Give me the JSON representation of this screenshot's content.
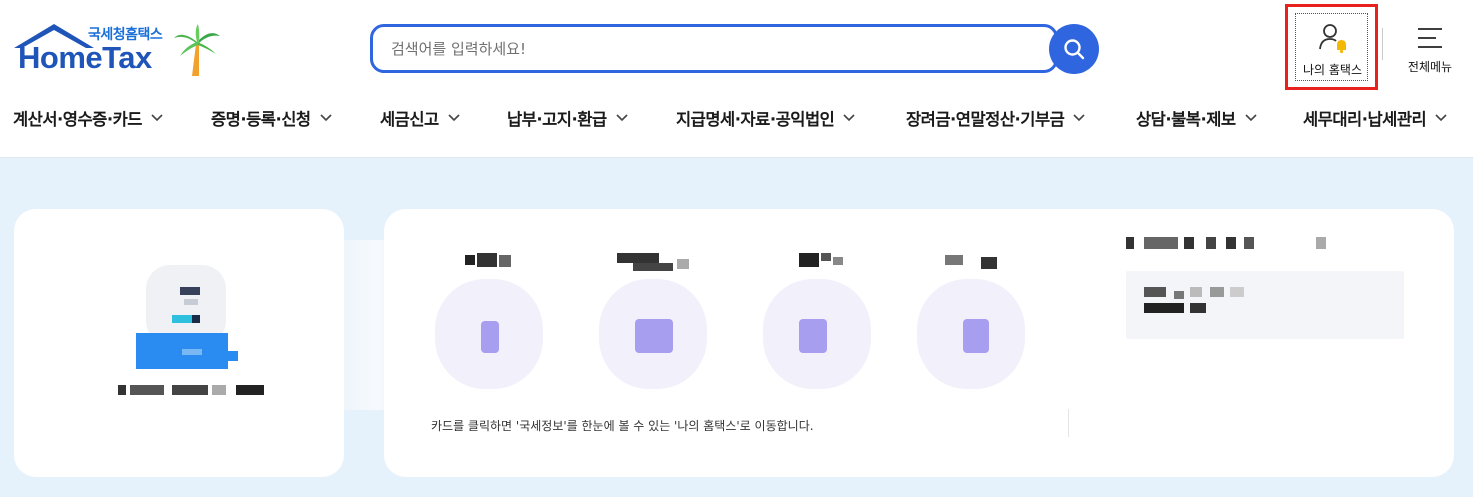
{
  "brand": {
    "sub": "국세청홈택스",
    "main": "HomeTax",
    "colors": {
      "primary": "#2f66e0",
      "logo": "#1f55b8",
      "highlight": "#e8201e"
    }
  },
  "search": {
    "placeholder": "검색어를 입력하세요!",
    "icon": "search-icon"
  },
  "header_actions": {
    "my_hometax": {
      "label": "나의 홈택스",
      "icon": "user-bell-icon"
    },
    "all_menu": {
      "label": "전체메뉴",
      "icon": "menu-icon"
    }
  },
  "nav": {
    "items": [
      {
        "label": "계산서·영수증·카드"
      },
      {
        "label": "증명·등록·신청"
      },
      {
        "label": "세금신고"
      },
      {
        "label": "납부·고지·환급"
      },
      {
        "label": "지급명세·자료·공익법인"
      },
      {
        "label": "장려금·연말정산·기부금"
      },
      {
        "label": "상담·불복·제보"
      },
      {
        "label": "세무대리·납세관리"
      }
    ]
  },
  "main_card": {
    "hint": "카드를 클릭하면 '국세정보'를 한눈에 볼 수 있는 '나의 홈택스'로 이동합니다."
  }
}
